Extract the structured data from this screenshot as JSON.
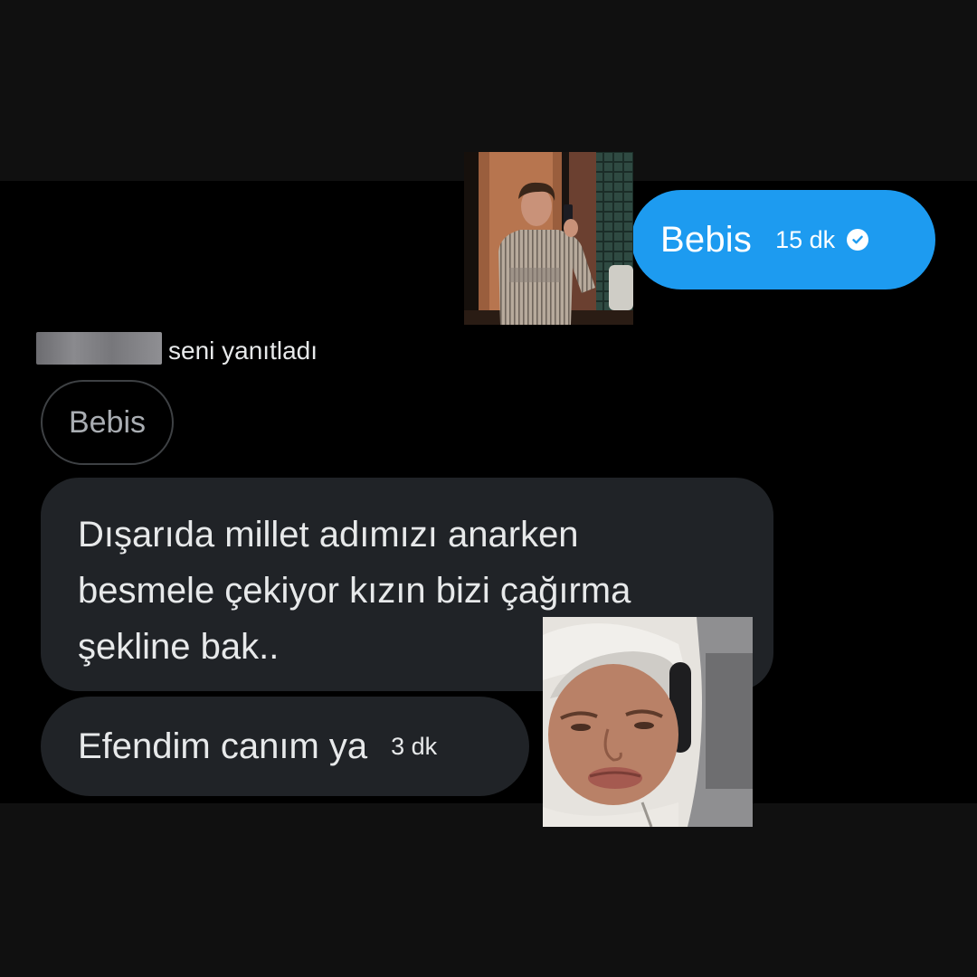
{
  "conversation": {
    "outgoing_message": {
      "text": "Bebis",
      "time": "15 dk",
      "status_icon": "check-circle-icon"
    },
    "reply_header": {
      "text": "seni yanıtladı"
    },
    "quoted_message": {
      "text": "Bebis"
    },
    "incoming_messages": [
      {
        "lines": [
          "Dışarıda millet adımızı anarken",
          "besmele çekiyor kızın bizi çağırma",
          "şekline bak.."
        ]
      },
      {
        "text": "Efendim canım ya",
        "time": "3 dk"
      }
    ]
  },
  "colors": {
    "outgoing_bubble": "#1d9bf0",
    "incoming_bubble": "#202327",
    "chat_background": "#000000",
    "text_primary": "#e7e9ea"
  }
}
